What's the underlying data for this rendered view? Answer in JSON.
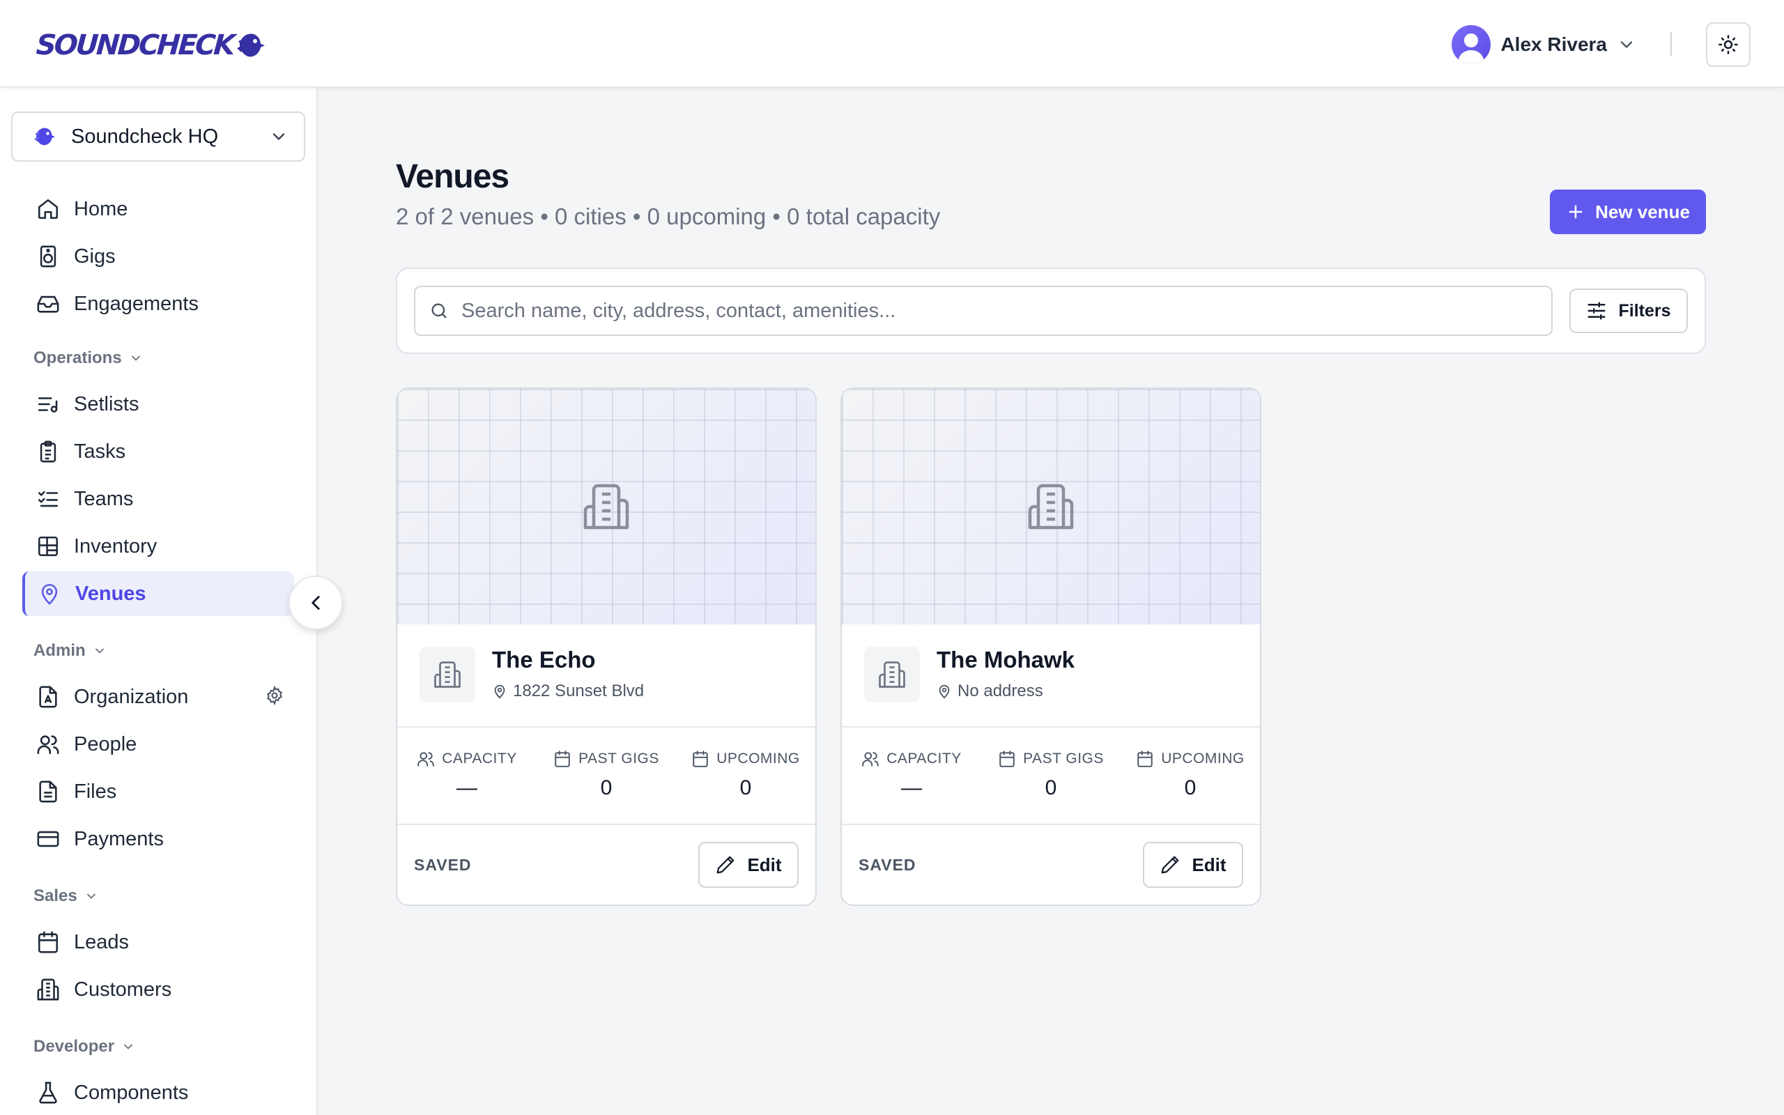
{
  "brand": {
    "logo_text": "SOUNDCHECK"
  },
  "user": {
    "name": "Alex Rivera"
  },
  "workspace": {
    "name": "Soundcheck HQ"
  },
  "nav": {
    "main": [
      {
        "label": "Home",
        "icon": "home-icon"
      },
      {
        "label": "Gigs",
        "icon": "speaker-icon"
      },
      {
        "label": "Engagements",
        "icon": "inbox-icon"
      }
    ],
    "operations": {
      "title": "Operations",
      "items": [
        {
          "label": "Setlists",
          "icon": "setlist-icon"
        },
        {
          "label": "Tasks",
          "icon": "clipboard-icon"
        },
        {
          "label": "Teams",
          "icon": "checklist-icon"
        },
        {
          "label": "Inventory",
          "icon": "layout-grid-icon"
        },
        {
          "label": "Venues",
          "icon": "map-pin-icon",
          "active": true
        }
      ]
    },
    "admin": {
      "title": "Admin",
      "items": [
        {
          "label": "Organization",
          "icon": "org-file-icon"
        },
        {
          "label": "People",
          "icon": "users-icon"
        },
        {
          "label": "Files",
          "icon": "file-icon"
        },
        {
          "label": "Payments",
          "icon": "credit-card-icon"
        }
      ]
    },
    "sales": {
      "title": "Sales",
      "items": [
        {
          "label": "Leads",
          "icon": "calendar-icon"
        },
        {
          "label": "Customers",
          "icon": "building-icon"
        }
      ]
    },
    "developer": {
      "title": "Developer",
      "items": [
        {
          "label": "Components",
          "icon": "flask-icon"
        }
      ]
    }
  },
  "page": {
    "title": "Venues",
    "summary": "2 of 2 venues • 0 cities • 0 upcoming • 0 total capacity",
    "new_button": "New venue"
  },
  "search": {
    "placeholder": "Search name, city, address, contact, amenities...",
    "value": "",
    "filters_label": "Filters"
  },
  "venues": [
    {
      "name": "The Echo",
      "address": "1822 Sunset Blvd",
      "stats": [
        {
          "label": "CAPACITY",
          "value": "—",
          "icon": "users-icon"
        },
        {
          "label": "PAST GIGS",
          "value": "0",
          "icon": "calendar-icon"
        },
        {
          "label": "UPCOMING",
          "value": "0",
          "icon": "calendar-icon"
        }
      ],
      "status": "SAVED",
      "edit_label": "Edit"
    },
    {
      "name": "The Mohawk",
      "address": "No address",
      "stats": [
        {
          "label": "CAPACITY",
          "value": "—",
          "icon": "users-icon"
        },
        {
          "label": "PAST GIGS",
          "value": "0",
          "icon": "calendar-icon"
        },
        {
          "label": "UPCOMING",
          "value": "0",
          "icon": "calendar-icon"
        }
      ],
      "status": "SAVED",
      "edit_label": "Edit"
    }
  ],
  "colors": {
    "accent": "#6159ee",
    "active_bg": "#eceefc",
    "active_text": "#4f46e5",
    "logo": "#3730a3"
  }
}
